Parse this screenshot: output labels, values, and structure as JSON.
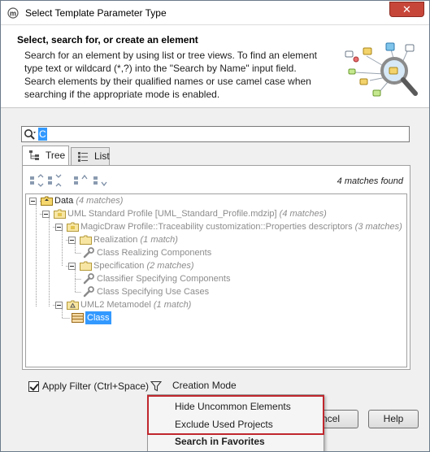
{
  "window": {
    "title": "Select Template Parameter Type",
    "close_glyph": "✕"
  },
  "header": {
    "title": "Select, search for, or create an element",
    "description": "Search for an element by using list or tree views. To find an element type text or wildcard (*,?) into the \"Search by Name\" input field. Search elements by their qualified names or use camel case when searching if the appropriate mode is enabled."
  },
  "search": {
    "value": "C",
    "icon": "search-icon"
  },
  "tabs": [
    {
      "label": "Tree",
      "icon": "tree-icon",
      "active": true
    },
    {
      "label": "List",
      "icon": "list-icon",
      "active": false
    }
  ],
  "toolbar": {
    "matches_found": "4 matches found"
  },
  "tree": {
    "rows": [
      {
        "label": "Data",
        "count": "(4 matches)"
      },
      {
        "label": "UML Standard Profile [UML_Standard_Profile.mdzip]",
        "count": "(4 matches)"
      },
      {
        "label": "MagicDraw Profile::Traceability customization::Properties descriptors",
        "count": "(3 matches)"
      },
      {
        "label": "Realization",
        "count": "(1 match)"
      },
      {
        "label": "Class Realizing Components",
        "count": ""
      },
      {
        "label": "Specification",
        "count": "(2 matches)"
      },
      {
        "label": "Classifier Specifying Components",
        "count": ""
      },
      {
        "label": "Class Specifying Use Cases",
        "count": ""
      },
      {
        "label": "UML2 Metamodel",
        "count": "(1 match)"
      },
      {
        "label": "Class",
        "count": ""
      }
    ]
  },
  "filter": {
    "apply_label": "Apply Filter (Ctrl+Space)",
    "checked": true,
    "creation_mode": "Creation Mode"
  },
  "buttons": {
    "cancel": "ncel",
    "help": "Help"
  },
  "menu": {
    "items": [
      "Hide Uncommon Elements",
      "Exclude Used Projects",
      "Search in Favorites"
    ]
  },
  "colors": {
    "selection": "#3399ff",
    "highlight_border": "#c0272d",
    "folder": "#f5d76e"
  }
}
